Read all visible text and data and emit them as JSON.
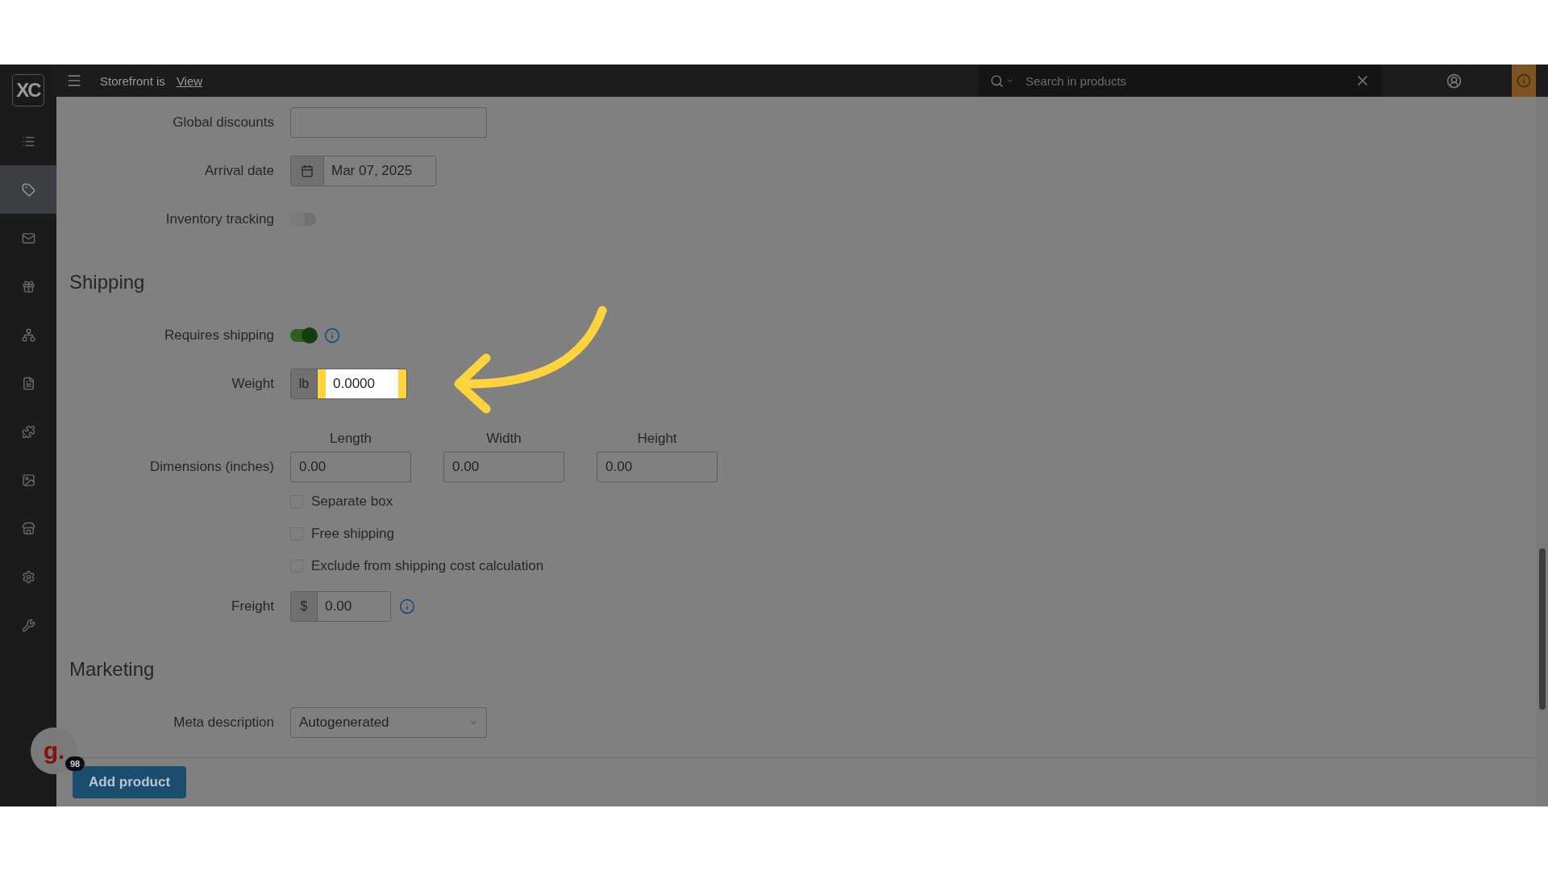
{
  "logo": "XC",
  "topbar": {
    "storefront_text": "Storefront is",
    "view_link": "View",
    "search": {
      "placeholder": "Search in products"
    }
  },
  "sidebar": {
    "items": [
      {
        "selected": false
      },
      {
        "selected": true
      },
      {
        "selected": false
      },
      {
        "selected": false
      },
      {
        "selected": false
      },
      {
        "selected": false
      },
      {
        "selected": false
      },
      {
        "selected": false
      },
      {
        "selected": false
      },
      {
        "selected": false
      },
      {
        "selected": false
      }
    ]
  },
  "rows": [
    {
      "kind": "text",
      "label": "Global discounts"
    },
    {
      "kind": "date",
      "label": "Arrival date",
      "value": "Mar 07, 2025"
    },
    {
      "kind": "toggle",
      "label": "Inventory tracking",
      "on": false
    }
  ],
  "sections": [
    {
      "title": "Shipping",
      "rows": [
        {
          "kind": "toggle",
          "label": "Requires shipping",
          "on": true,
          "info": true
        },
        {
          "kind": "unit",
          "label": "Weight",
          "unit": "lb",
          "value": "0.0000",
          "highlighted": true
        },
        {
          "kind": "dimensions",
          "label": "Dimensions (inches)",
          "parts": [
            {
              "caption": "Length",
              "value": "0.00"
            },
            {
              "caption": "Width",
              "value": "0.00"
            },
            {
              "caption": "Height",
              "value": "0.00"
            }
          ]
        },
        {
          "kind": "checkbox",
          "label": "Separate box",
          "checked": false
        },
        {
          "kind": "checkbox",
          "label": "Free shipping",
          "checked": false
        },
        {
          "kind": "checkbox",
          "label": "Exclude from shipping cost calculation",
          "checked": false
        },
        {
          "kind": "unit",
          "label": "Freight",
          "unit": "$",
          "value": "0.00",
          "info": true
        }
      ]
    },
    {
      "title": "Marketing",
      "rows": [
        {
          "kind": "select",
          "label": "Meta description",
          "value": "Autogenerated"
        }
      ]
    }
  ],
  "footer": {
    "button": "Add product"
  },
  "assistant": {
    "letter": "g.",
    "count": "98"
  }
}
